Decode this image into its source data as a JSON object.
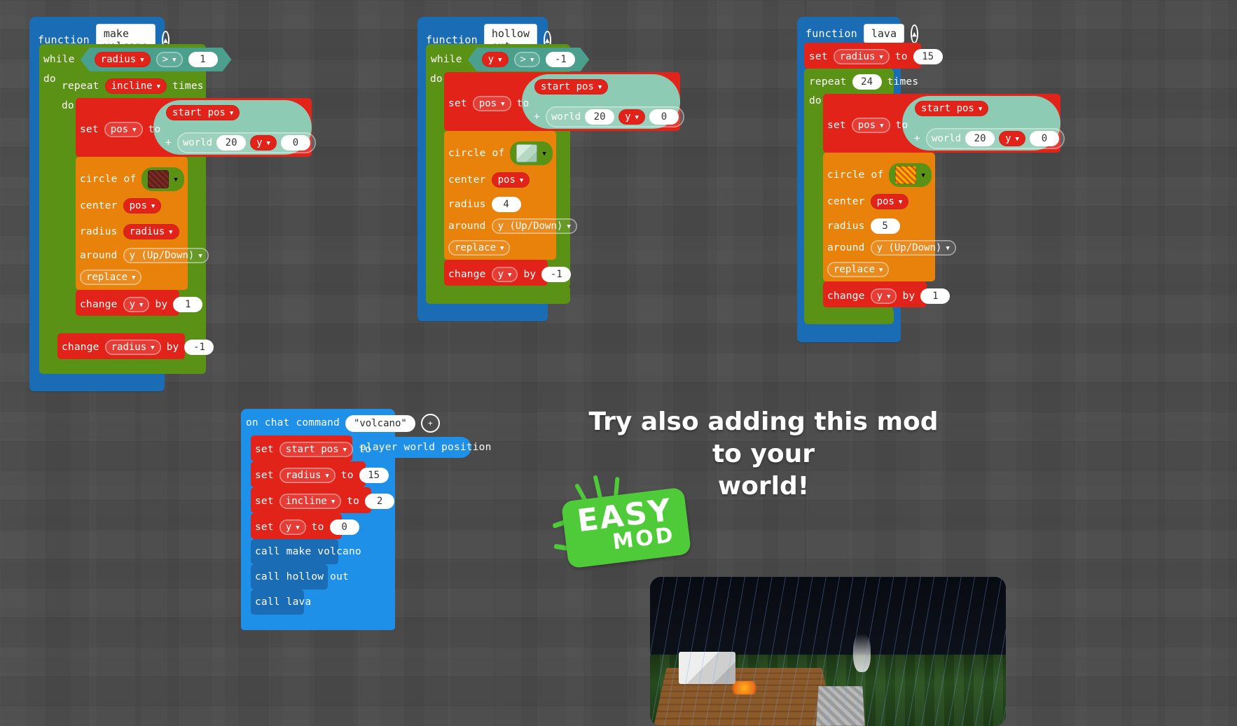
{
  "app": {
    "name": "MakeCode for Minecraft - Blocks Editor",
    "background_color": "#4a4a4a"
  },
  "colors": {
    "function_blue": "#1a6cb5",
    "loop_green": "#5a9216",
    "variable_red": "#e2231a",
    "builder_orange": "#e8820b",
    "position_mint": "#8ecbb4",
    "logic_teal": "#4aa08c",
    "player_blue": "#1e90e8",
    "badge_green": "#4fcb3a"
  },
  "functions": [
    {
      "keyword": "function",
      "name": "make volcano",
      "collapse_icon": "chevron-up-circle-icon",
      "while": {
        "label": "while",
        "do_label": "do",
        "variable": "radius",
        "operator": ">",
        "value": "1"
      },
      "repeat": {
        "label": "repeat",
        "times_label": "times",
        "do_label": "do",
        "count_variable": "incline"
      },
      "set_pos": {
        "label": "set",
        "variable": "pos",
        "to_label": "to",
        "start_pos": "start pos",
        "plus": "+",
        "world": "world",
        "x": "20",
        "y_axis": "y",
        "z": "0"
      },
      "circle": {
        "of_label": "circle of",
        "block_icon": "netherrack-block-icon",
        "center_label": "center",
        "center_value": "pos",
        "radius_label": "radius",
        "radius_value": "radius",
        "around_label": "around",
        "around_value": "y (Up/Down)",
        "operation": "replace"
      },
      "change_inner": {
        "label": "change",
        "variable": "y",
        "by_label": "by",
        "value": "1"
      },
      "change_outer": {
        "label": "change",
        "variable": "radius",
        "by_label": "by",
        "value": "-1"
      }
    },
    {
      "keyword": "function",
      "name": "hollow out",
      "collapse_icon": "chevron-up-circle-icon",
      "while": {
        "label": "while",
        "do_label": "do",
        "variable": "y",
        "operator": ">",
        "value": "-1"
      },
      "set_pos": {
        "label": "set",
        "variable": "pos",
        "to_label": "to",
        "start_pos": "start pos",
        "plus": "+",
        "world": "world",
        "x": "20",
        "y_axis": "y",
        "z": "0"
      },
      "circle": {
        "of_label": "circle of",
        "block_icon": "air-block-icon",
        "center_label": "center",
        "center_value": "pos",
        "radius_label": "radius",
        "radius_value": "4",
        "around_label": "around",
        "around_value": "y (Up/Down)",
        "operation": "replace"
      },
      "change_inner": {
        "label": "change",
        "variable": "y",
        "by_label": "by",
        "value": "-1"
      }
    },
    {
      "keyword": "function",
      "name": "lava",
      "collapse_icon": "chevron-up-circle-icon",
      "set_radius": {
        "label": "set",
        "variable": "radius",
        "to_label": "to",
        "value": "15"
      },
      "repeat": {
        "label": "repeat",
        "count": "24",
        "times_label": "times",
        "do_label": "do"
      },
      "set_pos": {
        "label": "set",
        "variable": "pos",
        "to_label": "to",
        "start_pos": "start pos",
        "plus": "+",
        "world": "world",
        "x": "20",
        "y_axis": "y",
        "z": "0"
      },
      "circle": {
        "of_label": "circle of",
        "block_icon": "magma-block-icon",
        "center_label": "center",
        "center_value": "pos",
        "radius_label": "radius",
        "radius_value": "5",
        "around_label": "around",
        "around_value": "y (Up/Down)",
        "operation": "replace"
      },
      "change_inner": {
        "label": "change",
        "variable": "y",
        "by_label": "by",
        "value": "1"
      }
    }
  ],
  "chat_command": {
    "label": "on chat command",
    "command": "\"volcano\"",
    "add_icon": "plus-circle-icon",
    "statements": [
      {
        "label": "set",
        "variable": "start pos",
        "to_label": "to",
        "reporter": "player world position"
      },
      {
        "label": "set",
        "variable": "radius",
        "to_label": "to",
        "value": "15"
      },
      {
        "label": "set",
        "variable": "incline",
        "to_label": "to",
        "value": "2"
      },
      {
        "label": "set",
        "variable": "y",
        "to_label": "to",
        "value": "0"
      }
    ],
    "calls": [
      {
        "label": "call make volcano"
      },
      {
        "label": "call hollow out"
      },
      {
        "label": "call lava"
      }
    ]
  },
  "promo": {
    "title_line1": "Try also adding this mod to your",
    "title_line2": "world!",
    "badge_top": "EASY",
    "badge_bottom": "MOD",
    "screenshot_alt": "minecraft-night-rain-campfire-screenshot"
  }
}
